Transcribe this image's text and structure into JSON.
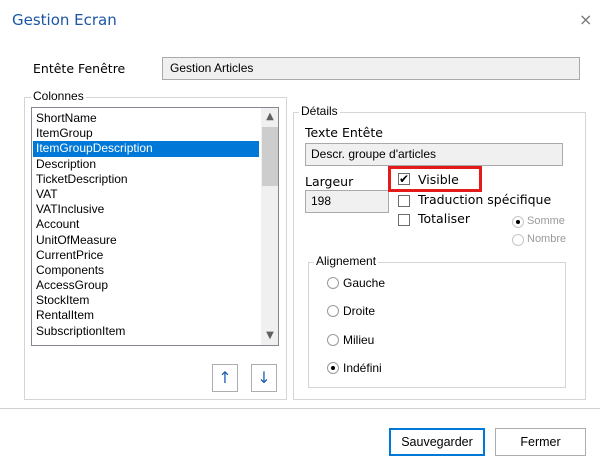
{
  "window": {
    "title": "Gestion Ecran",
    "close_glyph": "×"
  },
  "header": {
    "label": "Entête Fenêtre",
    "value": "Gestion Articles"
  },
  "columns": {
    "group_title": "Colonnes",
    "items": [
      "ShortName",
      "ItemGroup",
      "ItemGroupDescription",
      "Description",
      "TicketDescription",
      "VAT",
      "VATInclusive",
      "Account",
      "UnitOfMeasure",
      "CurrentPrice",
      "Components",
      "AccessGroup",
      "StockItem",
      "RentalItem",
      "SubscriptionItem"
    ],
    "selected_index": 2,
    "move_up_glyph": "↑",
    "move_down_glyph": "↓"
  },
  "details": {
    "group_title": "Détails",
    "texte_label": "Texte Entête",
    "texte_value": "Descr. groupe d'articles",
    "largeur_label": "Largeur",
    "largeur_value": "198",
    "visible_label": "Visible",
    "visible_checked": true,
    "traduction_label": "Traduction spécifique",
    "totaliser_label": "Totaliser",
    "somme_label": "Somme",
    "nombre_label": "Nombre",
    "alignement": {
      "group_title": "Alignement",
      "options": [
        "Gauche",
        "Droite",
        "Milieu",
        "Indéfini"
      ],
      "selected": "Indéfini"
    }
  },
  "footer": {
    "save_label": "Sauvegarder",
    "close_label": "Fermer"
  },
  "colors": {
    "accent": "#0078d7",
    "title": "#1a56a6",
    "highlight": "#e31b1b"
  }
}
